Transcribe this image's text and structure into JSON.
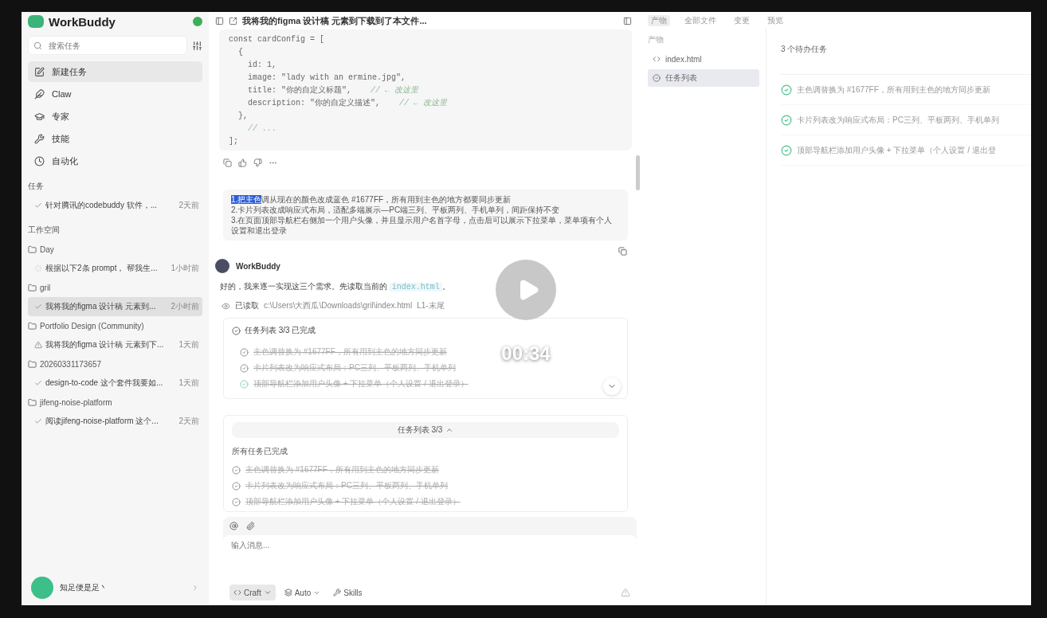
{
  "video": {
    "time": "00:34"
  },
  "sidebar": {
    "app_name": "WorkBuddy",
    "search": {
      "placeholder": "搜索任务"
    },
    "nav": [
      {
        "label": "新建任务",
        "kind": "new",
        "selected": true
      },
      {
        "label": "Claw",
        "kind": "claw",
        "selected": false
      },
      {
        "label": "专家",
        "kind": "expert",
        "selected": false
      },
      {
        "label": "技能",
        "kind": "skill",
        "selected": false
      },
      {
        "label": "自动化",
        "kind": "auto",
        "selected": false
      }
    ],
    "tasks_heading": "任务",
    "tasks": [
      {
        "title": "针对腾讯的codebuddy 软件，...",
        "time": "2天前",
        "kind": "done",
        "selected": false
      }
    ],
    "workspace_heading": "工作空间",
    "workspaces": [
      {
        "name": "Day",
        "children": [
          {
            "title": "根据以下2条 prompt， 帮我生...",
            "time": "1小时前",
            "kind": "running",
            "selected": false
          }
        ]
      },
      {
        "name": "gril",
        "children": [
          {
            "title": "我将我的figma 设计稿 元素到...",
            "time": "2小时前",
            "kind": "done",
            "selected": true
          }
        ]
      },
      {
        "name": "Portfolio Design (Community)",
        "children": [
          {
            "title": "我将我的figma 设计稿 元素到下...",
            "time": "1天前",
            "kind": "warning",
            "selected": false
          }
        ]
      },
      {
        "name": "20260331173657",
        "children": [
          {
            "title": "design-to-code 这个套件我要如...",
            "time": "1天前",
            "kind": "done",
            "selected": false
          }
        ]
      },
      {
        "name": "jifeng-noise-platform",
        "children": [
          {
            "title": "阅读jifeng-noise-platform 这个...",
            "time": "2天前",
            "kind": "done",
            "selected": false
          }
        ]
      }
    ],
    "user": {
      "name": "知足便是足丶"
    }
  },
  "chat": {
    "title": "我将我的figma 设计稿 元素到下载到了本文件...",
    "code": [
      {
        "code": "const cardConfig = ["
      },
      {
        "code": "  {"
      },
      {
        "code": "    id: 1,"
      },
      {
        "code": "    image: \"lady with an ermine.jpg\","
      },
      {
        "code": "    title: \"你的自定义标题\",",
        "comment": "// ← 改这里"
      },
      {
        "code": "    description: \"你的自定义描述\",",
        "comment": "// ← 改这里"
      },
      {
        "code": "  },"
      },
      {
        "comment": "// ..."
      },
      {
        "code": "];"
      }
    ],
    "user_message": {
      "selection": "1.把主色",
      "text": "调从现在的颜色改成蓝色 #1677FF，所有用到主色的地方都要同步更新\n2.卡片列表改成响应式布局，适配多端展示—PC端三列、平板两列、手机单列，间距保持不变\n3.在页面顶部导航栏右侧加一个用户头像，并且显示用户名首字母，点击后可以展示下拉菜单，菜单项有个人设置和退出登录"
    },
    "bot_name": "WorkBuddy",
    "reply_text": "好的，我来逐一实现这三个需求。先读取当前的",
    "reply_code": "index.html",
    "reply_end": "。",
    "read": {
      "label": "已读取",
      "path": "c:\\Users\\大西瓜\\Downloads\\gril\\index.html",
      "range": "L1-末尾"
    },
    "task_card": {
      "title": "任务列表 3/3 已完成",
      "items": [
        {
          "text": "主色调替换为 #1677FF，所有用到主色的地方同步更新",
          "done": true,
          "current": false
        },
        {
          "text": "卡片列表改为响应式布局：PC三列、平板两列、手机单列",
          "done": true,
          "current": false
        },
        {
          "text": "顶部导航栏添加用户头像 + 下拉菜单（个人设置 / 退出登录）",
          "done": true,
          "current": true
        }
      ]
    },
    "summary_card": {
      "toggle": "任务列表 3/3",
      "expanded": true,
      "status": "所有任务已完成",
      "items": [
        {
          "text": "主色调替换为 #1677FF，所有用到主色的地方同步更新",
          "done": true
        },
        {
          "text": "卡片列表改为响应式布局：PC三列、平板两列、手机单列",
          "done": true
        },
        {
          "text": "顶部导航栏添加用户头像 + 下拉菜单（个人设置 / 退出登录）",
          "done": true
        }
      ]
    },
    "input": {
      "placeholder": "输入消息...",
      "mode": "Craft",
      "model": "Auto",
      "skills": "Skills"
    }
  },
  "panel": {
    "tabs": [
      {
        "label": "产物",
        "selected": true
      },
      {
        "label": "全部文件",
        "selected": false
      },
      {
        "label": "变更",
        "selected": false
      },
      {
        "label": "预览",
        "selected": false
      }
    ],
    "heading": "产物",
    "files": [
      {
        "label": "index.html",
        "kind": "code",
        "selected": false
      },
      {
        "label": "任务列表",
        "kind": "tasks",
        "selected": true
      }
    ],
    "todo_title": "3 个待办任务",
    "todos": [
      {
        "text": "主色调替换为 #1677FF，所有用到主色的地方同步更新",
        "done": true
      },
      {
        "text": "卡片列表改为响应式布局：PC三列、平板两列、手机单列",
        "done": true
      },
      {
        "text": "顶部导航栏添加用户头像 + 下拉菜单（个人设置 / 退出登",
        "done": true
      }
    ]
  }
}
